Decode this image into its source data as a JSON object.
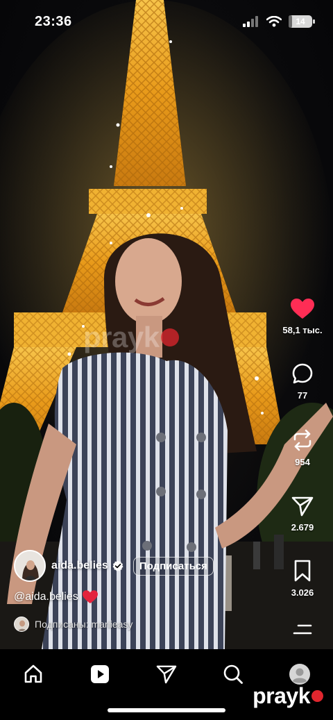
{
  "status_bar": {
    "time": "23:36",
    "battery_label": "14",
    "battery_level": 0.14
  },
  "actions": {
    "like_count": "58,1 тыс.",
    "comment_count": "77",
    "repost_count": "954",
    "share_count": "2.679",
    "save_count": "3.026"
  },
  "post": {
    "username": "aida.belies",
    "follow_label": "Подписаться",
    "caption": "@aida.belies",
    "followed_by": "Подписаны: mariieasy"
  },
  "watermark": {
    "text": "prayk"
  },
  "nav": {
    "items": [
      "home-icon",
      "reels-icon",
      "send-icon",
      "search-icon",
      "profile-icon"
    ]
  },
  "colors": {
    "like": "#ff2d55",
    "brand_dot": "#e0262e",
    "background": "#000000",
    "tower_gold": "#f2a51c"
  }
}
